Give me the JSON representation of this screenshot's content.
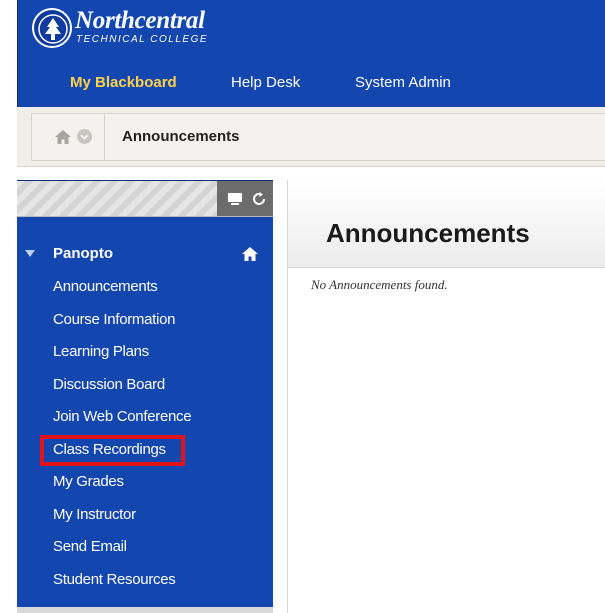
{
  "header": {
    "logo_name": "Northcentral",
    "logo_sub": "TECHNICAL COLLEGE",
    "tabs": [
      {
        "label": "My Blackboard",
        "active": true
      },
      {
        "label": "Help Desk",
        "active": false
      },
      {
        "label": "System Admin",
        "active": false
      }
    ]
  },
  "breadcrumb": {
    "current": "Announcements"
  },
  "sidebar": {
    "course_title": "Panopto",
    "items": [
      {
        "label": "Announcements"
      },
      {
        "label": "Course Information"
      },
      {
        "label": "Learning Plans"
      },
      {
        "label": "Discussion Board"
      },
      {
        "label": "Join Web Conference"
      },
      {
        "label": "Class Recordings",
        "highlighted": true
      },
      {
        "label": "My Grades"
      },
      {
        "label": "My Instructor"
      },
      {
        "label": "Send Email"
      },
      {
        "label": "Student Resources"
      }
    ]
  },
  "content": {
    "title": "Announcements",
    "empty_message": "No Announcements found."
  },
  "colors": {
    "brand_blue": "#1446b0",
    "active_tab": "#ffd24a",
    "highlight": "#e0131b"
  },
  "icons": {
    "logo": "pine-tree-globe-icon",
    "pin": "paperclip-pin-icon",
    "breadcrumb_home": "home-icon",
    "breadcrumb_menu": "chevron-down-icon",
    "display": "display-icon",
    "refresh": "refresh-icon",
    "course_home": "home-icon"
  }
}
